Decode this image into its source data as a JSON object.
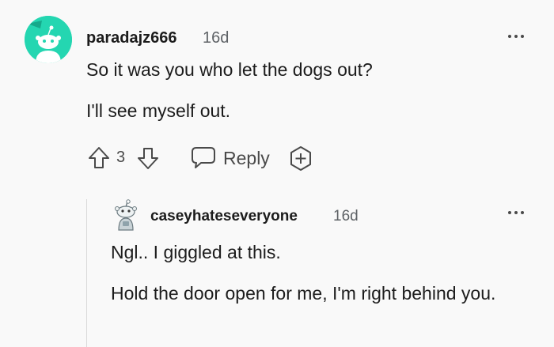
{
  "comment": {
    "username": "paradajz666",
    "time": "16d",
    "body": [
      "So it was you who let the dogs out?",
      "I'll see myself out."
    ],
    "score": "3",
    "reply_label": "Reply",
    "avatar_color": "#24d6b1"
  },
  "reply": {
    "username": "caseyhateseveryone",
    "time": "16d",
    "body": [
      "Ngl.. I giggled at this.",
      "Hold the door open for me, I'm right behind you."
    ]
  },
  "colors": {
    "background": "#f9f9f9",
    "text": "#1c1c1c",
    "meta": "#5e6266",
    "icon": "#4a4a4a",
    "thread_line": "#d9d9d9"
  },
  "icons": [
    "upvote-icon",
    "downvote-icon",
    "comment-bubble-icon",
    "award-plus-icon",
    "more-options-icon"
  ]
}
